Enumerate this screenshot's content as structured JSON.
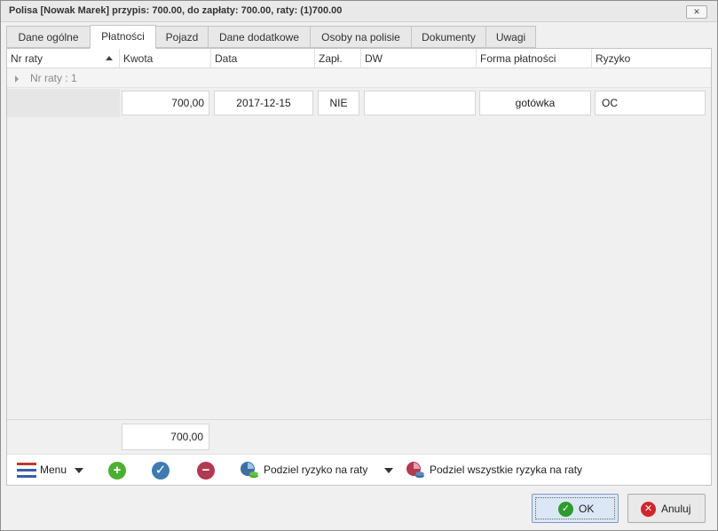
{
  "window": {
    "title": "Polisa [Nowak Marek] przypis: 700.00, do zapłaty: 700.00, raty: (1)700.00",
    "close_glyph": "×"
  },
  "tabs": [
    {
      "label": "Dane ogólne",
      "active": false
    },
    {
      "label": "Płatności",
      "active": true
    },
    {
      "label": "Pojazd",
      "active": false
    },
    {
      "label": "Dane dodatkowe",
      "active": false
    },
    {
      "label": "Osoby na polisie",
      "active": false
    },
    {
      "label": "Dokumenty",
      "active": false
    },
    {
      "label": "Uwagi",
      "active": false
    }
  ],
  "grid": {
    "columns": [
      "Nr raty",
      "Kwota",
      "Data",
      "Zapł.",
      "DW",
      "Forma płatności",
      "Ryzyko"
    ],
    "sorted_column": "Nr raty",
    "sort_direction": "ascending",
    "group_label": "Nr raty : 1",
    "rows": [
      {
        "kwota": "700,00",
        "data": "2017-12-15",
        "zapl": "NIE",
        "dw": "",
        "forma": "gotówka",
        "ryzyko": "OC"
      }
    ],
    "footer_total": "700,00"
  },
  "toolbar": {
    "menu_label": "Menu",
    "split_risk_label": "Podziel ryzyko na raty",
    "split_all_label": "Podziel wszystkie ryzyka na raty",
    "icons": [
      "menu-icon",
      "add-icon",
      "confirm-icon",
      "remove-icon",
      "split-risk-icon",
      "split-all-risks-icon"
    ]
  },
  "buttons": {
    "ok_label": "OK",
    "cancel_label": "Anuluj"
  },
  "colors": {
    "add": "#4caf30",
    "confirm": "#3d7bb0",
    "remove": "#b03a50",
    "ok_icon": "#2c9a2c",
    "cancel_icon": "#d0262f"
  }
}
